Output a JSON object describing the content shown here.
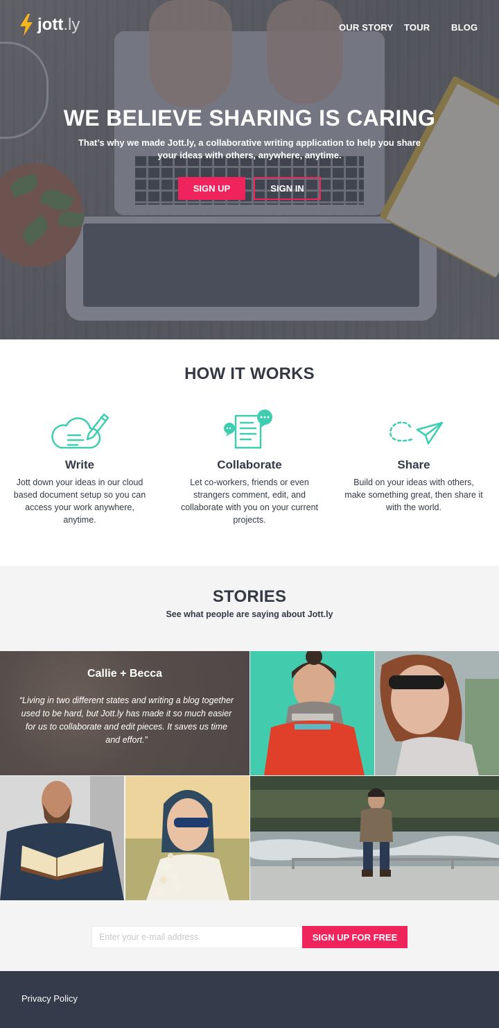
{
  "brand": {
    "name": "jott",
    "suffix": ".ly",
    "accent": "#f0245c",
    "bolt_color": "#f5b51d"
  },
  "nav": {
    "items": [
      "OUR STORY",
      "TOUR",
      "BLOG"
    ]
  },
  "hero": {
    "title": "WE BELIEVE SHARING IS CARING",
    "subtitle": "That’s why we made Jott.ly, a collaborative writing application to help you share your ideas with others, anywhere, anytime.",
    "signup_label": "SIGN UP",
    "signin_label": "SIGN IN"
  },
  "how": {
    "title": "HOW IT WORKS",
    "icon_color": "#3ecdb0",
    "features": [
      {
        "icon": "cloud-pencil-icon",
        "title": "Write",
        "text": "Jott down your ideas in our cloud based document setup so you can access your work anywhere, anytime."
      },
      {
        "icon": "document-comments-icon",
        "title": "Collaborate",
        "text": "Let co-workers, friends or even strangers comment, edit, and collaborate with you on your current projects."
      },
      {
        "icon": "paper-plane-icon",
        "title": "Share",
        "text": "Build on your ideas with others, make something great, then share it with the world."
      }
    ]
  },
  "stories": {
    "title": "STORIES",
    "subtitle": "See what people are saying about Jott.ly",
    "quote": {
      "name": "Callie + Becca",
      "text": "“Living in two different states and writing a blog together used to be hard, but Jott.ly has made it so much easier for us to collaborate and edit  pieces.  It saves us time and effort.”"
    }
  },
  "signup": {
    "placeholder": "Enter your e-mail address",
    "button_label": "SIGN UP FOR FREE"
  },
  "footer": {
    "privacy_label": "Privacy Policy",
    "background": "#353b4a"
  }
}
